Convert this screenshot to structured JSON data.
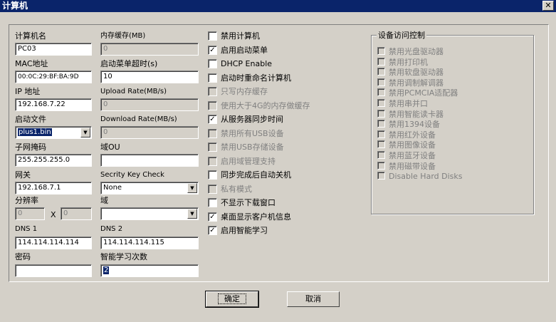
{
  "window": {
    "title": "计算机",
    "close_glyph": "✕"
  },
  "col1": {
    "computer_name": {
      "label": "计算机名",
      "value": "PC03"
    },
    "mac": {
      "label": "MAC地址",
      "value": "00:0C:29:BF:BA:9D"
    },
    "ip": {
      "label": "IP 地址",
      "value": "192.168.7.22"
    },
    "boot_file": {
      "label": "启动文件",
      "value": "plus1.bin"
    },
    "subnet": {
      "label": "子网掩码",
      "value": "255.255.255.0"
    },
    "gateway": {
      "label": "网关",
      "value": "192.168.7.1"
    },
    "resolution": {
      "label": "分辨率",
      "width": "0",
      "height": "0",
      "x": "X"
    },
    "dns1": {
      "label": "DNS 1",
      "value": "114.114.114.114"
    },
    "password": {
      "label": "密码",
      "value": ""
    }
  },
  "col2": {
    "mem_cache": {
      "label": "内存缓存(MB)",
      "value": "0"
    },
    "boot_menu_timeout": {
      "label": "启动菜单超时(s)",
      "value": "10"
    },
    "upload_rate": {
      "label": "Upload Rate(MB/s)",
      "value": "0"
    },
    "download_rate": {
      "label": "Download Rate(MB/s)",
      "value": "0"
    },
    "domain_ou": {
      "label": "域OU",
      "value": ""
    },
    "security_key": {
      "label": "Secrity Key Check",
      "value": "None"
    },
    "domain": {
      "label": "域",
      "value": ""
    },
    "dns2": {
      "label": "DNS 2",
      "value": "114.114.114.115"
    },
    "smart_learn_count": {
      "label": "智能学习次数",
      "value": "2"
    }
  },
  "options": [
    {
      "label": "禁用计算机",
      "checked": false,
      "disabled": false
    },
    {
      "label": "启用启动菜单",
      "checked": true,
      "disabled": false
    },
    {
      "label": "DHCP Enable",
      "checked": false,
      "disabled": false
    },
    {
      "label": "启动时重命名计算机",
      "checked": false,
      "disabled": false
    },
    {
      "label": "只写内存缓存",
      "checked": false,
      "disabled": true
    },
    {
      "label": "使用大于4G的内存做缓存",
      "checked": false,
      "disabled": true
    },
    {
      "label": "从服务器同步时间",
      "checked": true,
      "disabled": false
    },
    {
      "label": "禁用所有USB设备",
      "checked": false,
      "disabled": true
    },
    {
      "label": "禁用USB存储设备",
      "checked": false,
      "disabled": true
    },
    {
      "label": "启用域管理支持",
      "checked": false,
      "disabled": true
    },
    {
      "label": "同步完成后自动关机",
      "checked": false,
      "disabled": false
    },
    {
      "label": "私有模式",
      "checked": false,
      "disabled": true
    },
    {
      "label": "不显示下载窗口",
      "checked": false,
      "disabled": false
    },
    {
      "label": "桌面显示客户机信息",
      "checked": true,
      "disabled": false
    },
    {
      "label": "启用智能学习",
      "checked": true,
      "disabled": false
    }
  ],
  "device_group": {
    "title": "设备访问控制",
    "items": [
      "禁用光盘驱动器",
      "禁用打印机",
      "禁用软盘驱动器",
      "禁用调制解调器",
      "禁用PCMCIA适配器",
      "禁用串并口",
      "禁用智能读卡器",
      "禁用1394设备",
      "禁用红外设备",
      "禁用图像设备",
      "禁用蓝牙设备",
      "禁用磁带设备",
      "Disable Hard Disks"
    ]
  },
  "buttons": {
    "ok": "确定",
    "cancel": "取消"
  },
  "colors": {
    "titlebar": "#0a246a",
    "face": "#d4d0c8"
  },
  "icons": {
    "combo_arrow": "▼",
    "check_mark": "✓"
  }
}
